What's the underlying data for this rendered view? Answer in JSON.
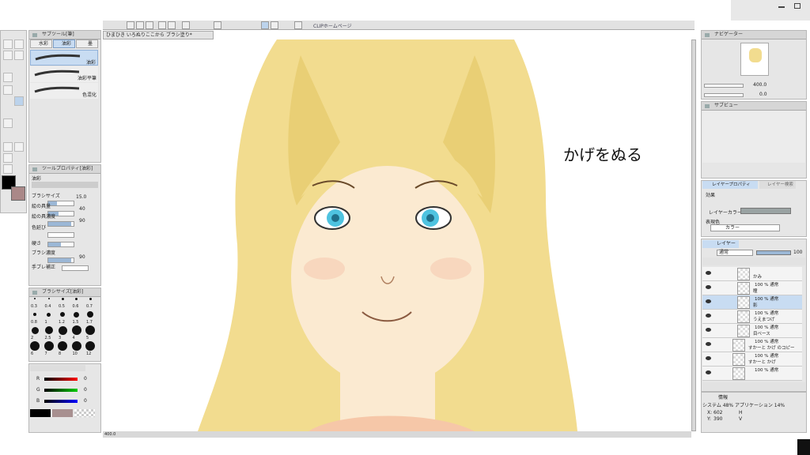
{
  "menubar": {
    "right_icons": [
      "minimize-icon",
      "restore-icon"
    ]
  },
  "toolbar": {
    "home_link": "CLIPホームページ"
  },
  "document": {
    "tab_title": "ひまひき いろぬりここから ブラシ塗り*"
  },
  "subtool": {
    "title": "サブツール[筆]",
    "tabs": [
      "水彩",
      "油彩",
      "墨"
    ],
    "brushes": [
      "油彩",
      "油彩平筆",
      "色混化"
    ]
  },
  "tool_property": {
    "title": "ツールプロパティ[油彩]",
    "name": "油彩",
    "rows": [
      {
        "label": "ブラシサイズ",
        "value": "15.0",
        "fill": 0.35
      },
      {
        "label": "絵の具量",
        "value": "40",
        "fill": 0.4
      },
      {
        "label": "絵の具濃度",
        "value": "90",
        "fill": 0.9
      },
      {
        "label": "色延び",
        "value": "",
        "fill": 0.0
      },
      {
        "label": "硬さ",
        "value": "",
        "fill": 0.5
      },
      {
        "label": "ブラシ濃度",
        "value": "90",
        "fill": 0.9
      },
      {
        "label": "手ブレ補正",
        "value": "",
        "fill": 0.0
      }
    ]
  },
  "brush_size": {
    "title": "ブラシサイズ[油彩]",
    "row1": [
      "0.3",
      "0.4",
      "0.5",
      "0.6",
      "0.7"
    ],
    "row2": [
      "0.8",
      "1",
      "1.2",
      "1.5",
      "1.7"
    ],
    "row3": [
      "2",
      "2.5",
      "3",
      "4",
      "5"
    ],
    "row4": [
      "6",
      "7",
      "8",
      "10",
      "12"
    ]
  },
  "color": {
    "channels": [
      {
        "label": "R",
        "value": "0"
      },
      {
        "label": "G",
        "value": "0"
      },
      {
        "label": "B",
        "value": "0"
      }
    ]
  },
  "canvas": {
    "annotation": "かげをぬる",
    "zoom": "400.0"
  },
  "navigator": {
    "title": "ナビゲーター",
    "zoom": "400.0",
    "angle": "0.0"
  },
  "subview": {
    "title": "サブビュー"
  },
  "layer_property": {
    "tabs": [
      "レイヤープロパティ",
      "レイヤー検索"
    ],
    "effect_label": "効果",
    "layer_color_label": "レイヤーカラー",
    "expression_label": "表現色",
    "expression_value": "カラー"
  },
  "layers": {
    "title": "レイヤー",
    "blend_mode": "通常",
    "opacity": "100",
    "items": [
      {
        "name": "かみ",
        "info": ""
      },
      {
        "name": "瞳",
        "info": "100 % 通常"
      },
      {
        "name": "影",
        "info": "100 % 通常"
      },
      {
        "name": "うえまつげ",
        "info": "100 % 通常"
      },
      {
        "name": "目ベース",
        "info": "100 % 通常"
      },
      {
        "name": "すかーと かげ のコピー",
        "info": "100 % 通常"
      },
      {
        "name": "すかーと かげ",
        "info": "100 % 通常"
      },
      {
        "name": "",
        "info": "100 % 通常"
      }
    ]
  },
  "info": {
    "title": "情報",
    "system": "システム 48% アプリケーション 14%",
    "x_label": "X:",
    "x": "602",
    "y_label": "Y:",
    "y": "390",
    "h_label": "H",
    "v_label": "V"
  }
}
